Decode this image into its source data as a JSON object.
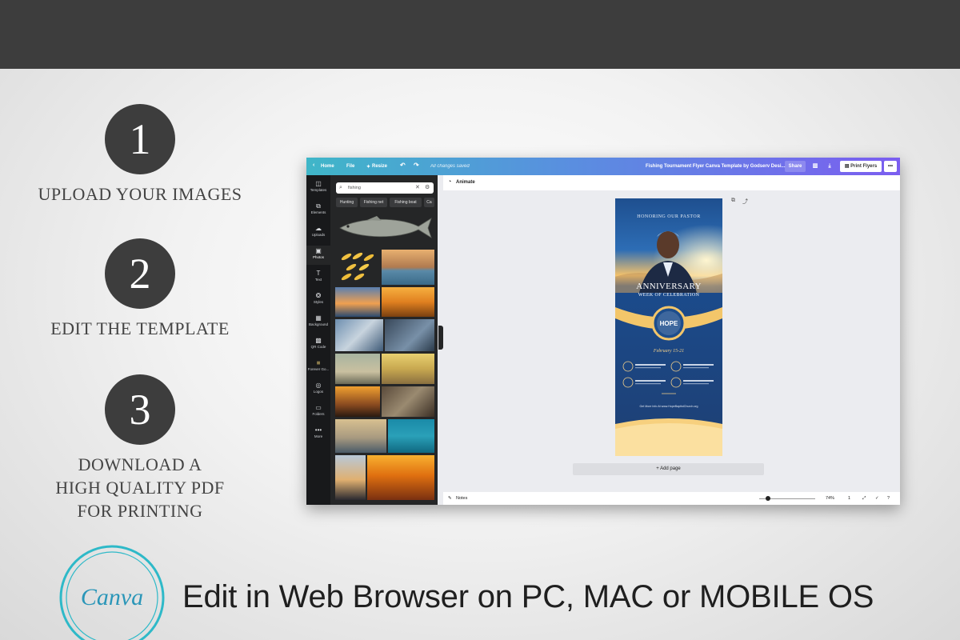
{
  "steps": [
    {
      "number": "1",
      "title": "UPLOAD YOUR IMAGES"
    },
    {
      "number": "2",
      "title": "EDIT THE TEMPLATE"
    },
    {
      "number": "3",
      "title_lines": [
        "DOWNLOAD A",
        "HIGH QUALITY PDF",
        "FOR PRINTING"
      ]
    }
  ],
  "editor": {
    "top_bar": {
      "home": "Home",
      "file": "File",
      "resize": "Resize",
      "saved": "All changes saved",
      "doc_title": "Fishing Tournament Flyer Canva Template by Godserv Desi...",
      "share": "Share",
      "print": "Print Flyers",
      "more": "•••"
    },
    "rail": [
      {
        "label": "Templates",
        "icon": "templates-icon"
      },
      {
        "label": "Elements",
        "icon": "elements-icon"
      },
      {
        "label": "Uploads",
        "icon": "uploads-icon"
      },
      {
        "label": "Photos",
        "icon": "photos-icon",
        "active": true
      },
      {
        "label": "Text",
        "icon": "text-icon"
      },
      {
        "label": "Styles",
        "icon": "styles-icon"
      },
      {
        "label": "Background",
        "icon": "background-icon"
      },
      {
        "label": "QR Code",
        "icon": "qr-code-icon"
      },
      {
        "label": "Forever Go...",
        "icon": "forever-go-icon"
      },
      {
        "label": "Logos",
        "icon": "logos-icon"
      },
      {
        "label": "Folders",
        "icon": "folders-icon"
      },
      {
        "label": "More",
        "icon": "more-icon"
      }
    ],
    "panel": {
      "search_value": "fishing",
      "chips": [
        "Hunting",
        "Fishing net",
        "Fishing boat",
        "Ca"
      ]
    },
    "animate": "Animate",
    "flyer": {
      "honoring": "HONORING OUR PASTOR",
      "anniversary": "ANNIVERSARY",
      "week": "WEEK OF CELEBRATION",
      "church": "HOPE",
      "dates": "February 15-21",
      "website": "Get More Info At www.HopeBaptistChurch.org"
    },
    "add_page": "+ Add page",
    "bottom": {
      "notes": "Notes",
      "zoom": "74%",
      "page": "1"
    }
  },
  "brand": {
    "logo_text": "Canva"
  },
  "tagline": "Edit in Web Browser on PC, MAC or MOBILE OS",
  "colors": {
    "dark": "#3d3d3d",
    "canva_teal": "#2eb9c8",
    "canva_logo_text": "#2a96b8"
  }
}
